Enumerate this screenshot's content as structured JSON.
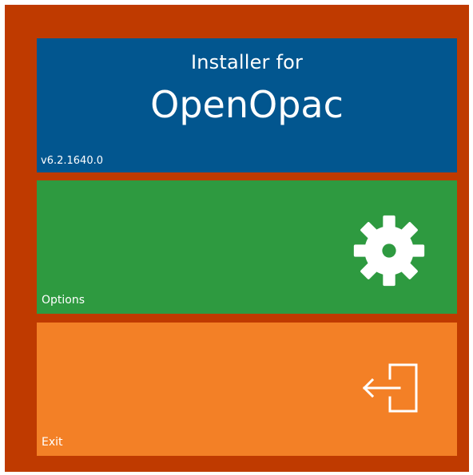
{
  "header": {
    "subtitle": "Installer for",
    "product_name": "OpenOpac",
    "version": "v6.2.1640.0"
  },
  "tiles": {
    "options": {
      "label": "Options",
      "icon": "gear-icon"
    },
    "exit": {
      "label": "Exit",
      "icon": "exit-icon"
    }
  },
  "colors": {
    "frame": "#bf3a00",
    "header_tile": "#02568f",
    "options_tile": "#2e9a40",
    "exit_tile": "#f38026"
  }
}
